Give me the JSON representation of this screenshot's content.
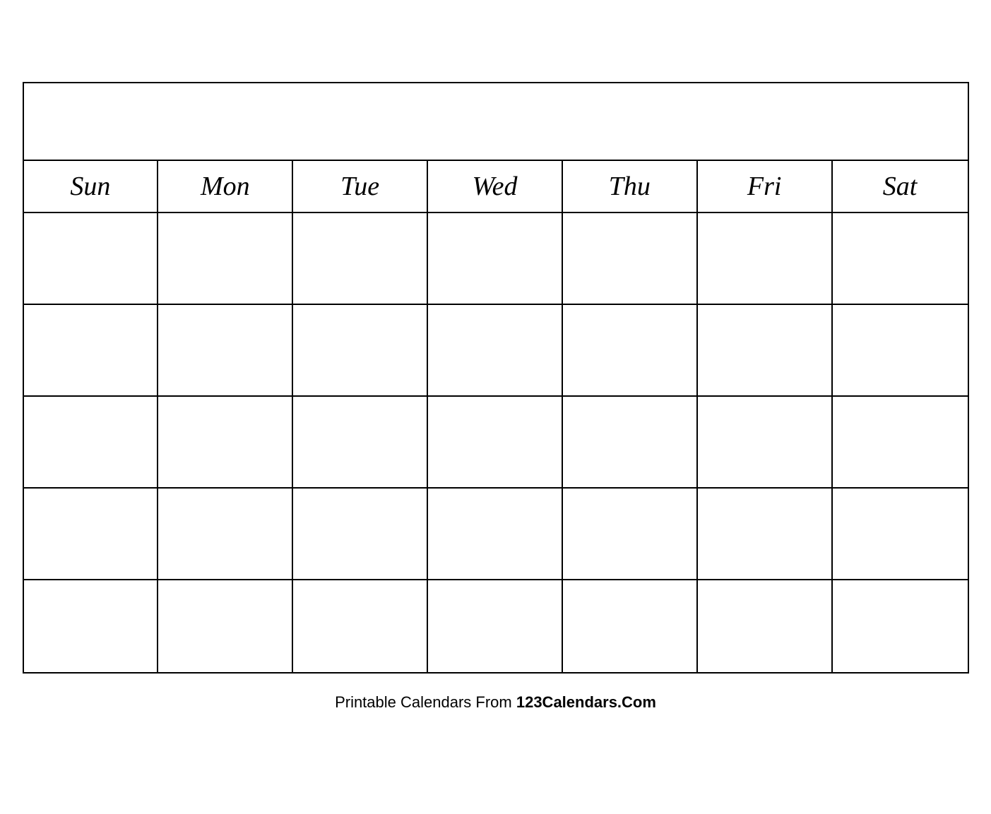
{
  "calendar": {
    "title": "",
    "days": [
      "Sun",
      "Mon",
      "Tue",
      "Wed",
      "Thu",
      "Fri",
      "Sat"
    ],
    "rows": 5,
    "cols": 7
  },
  "footer": {
    "prefix": "Printable Calendars From ",
    "brand": "123Calendars.Com"
  }
}
